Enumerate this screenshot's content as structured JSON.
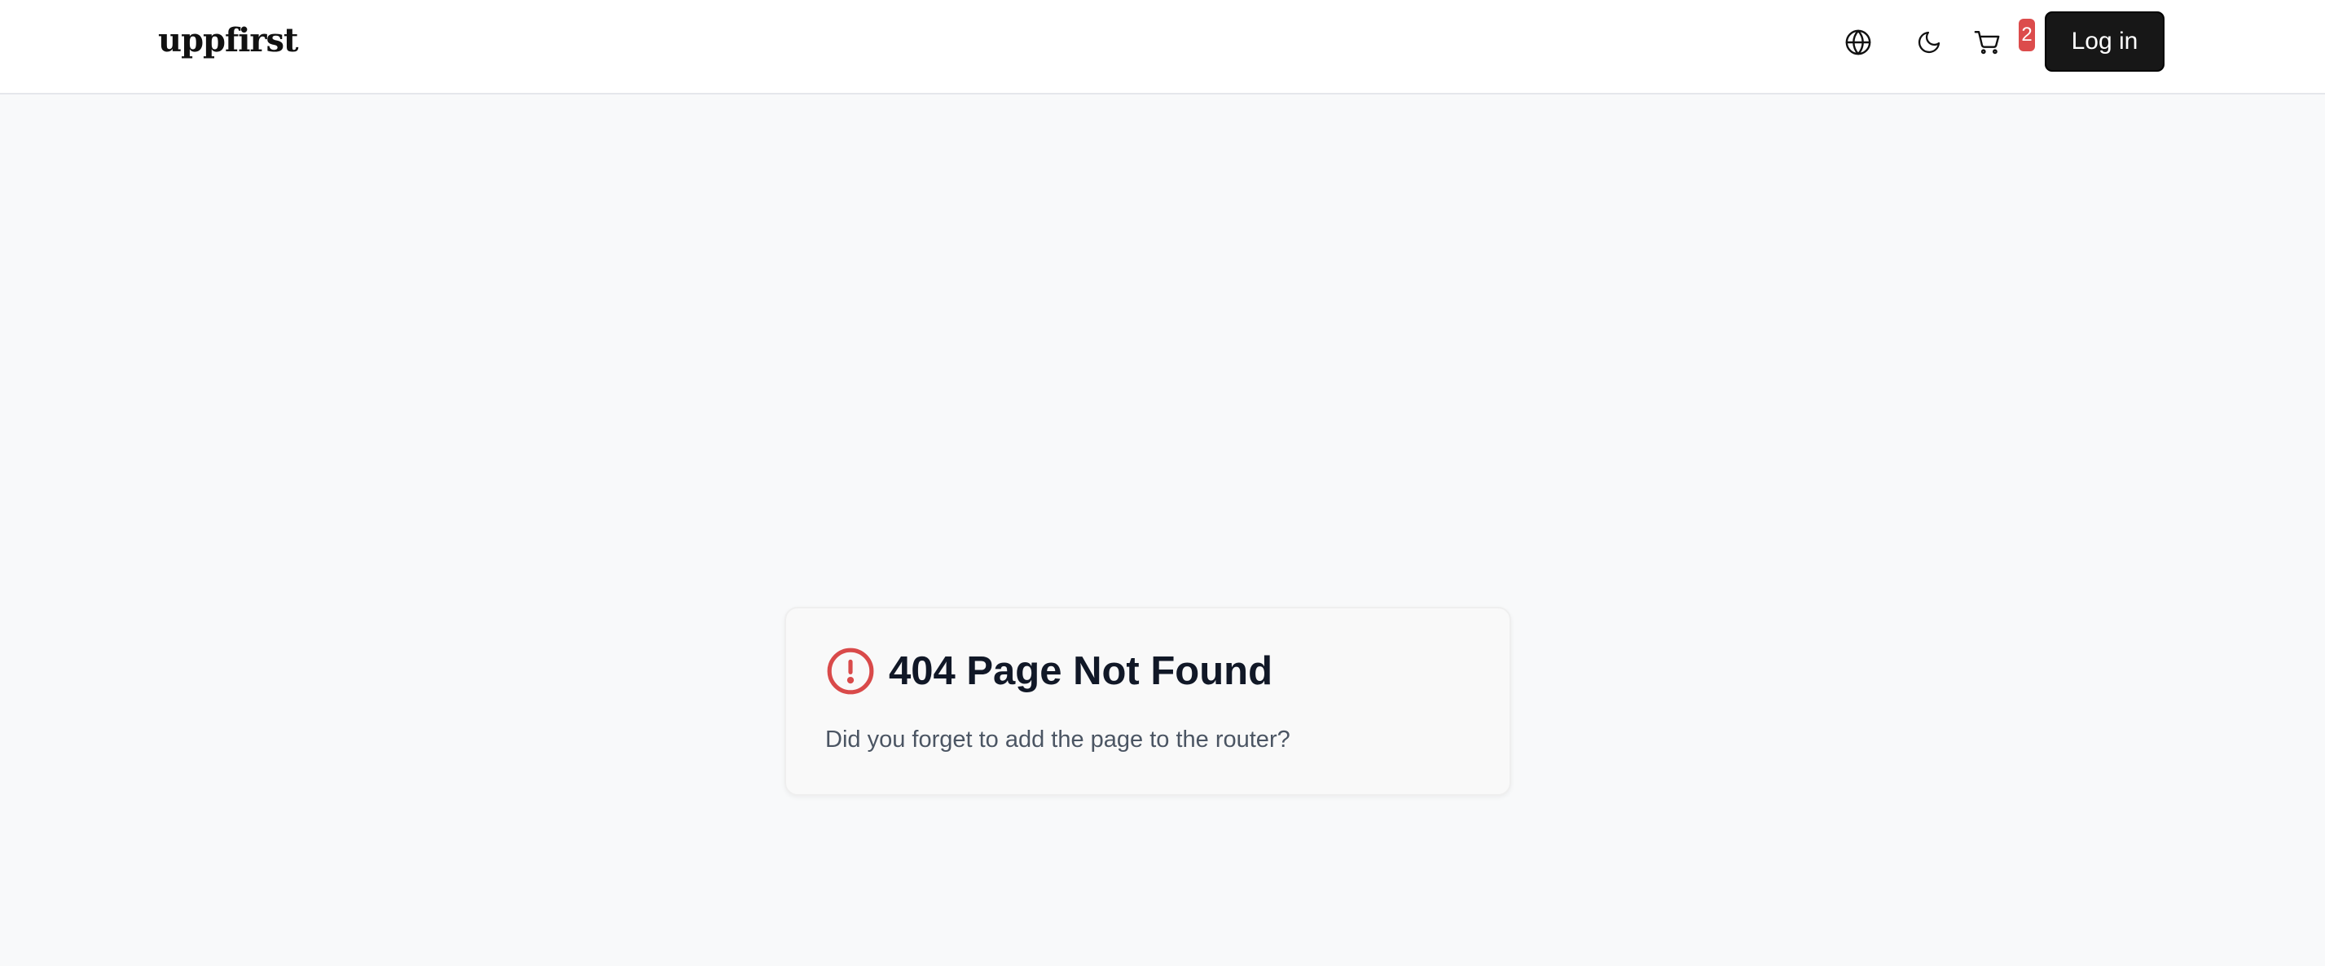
{
  "header": {
    "logo_text": "uppfirst",
    "language_icon": "globe-icon",
    "theme_icon": "moon-icon",
    "cart_icon": "shopping-cart-icon",
    "cart_count": "2",
    "login_label": "Log in"
  },
  "error_card": {
    "icon": "alert-circle-icon",
    "title": "404 Page Not Found",
    "message": "Did you forget to add the page to the router?"
  },
  "colors": {
    "background": "#f8f9fa",
    "header_background": "#ffffff",
    "login_button": "#171717",
    "badge": "#dc4c4c",
    "alert_icon": "#d94a4a"
  }
}
